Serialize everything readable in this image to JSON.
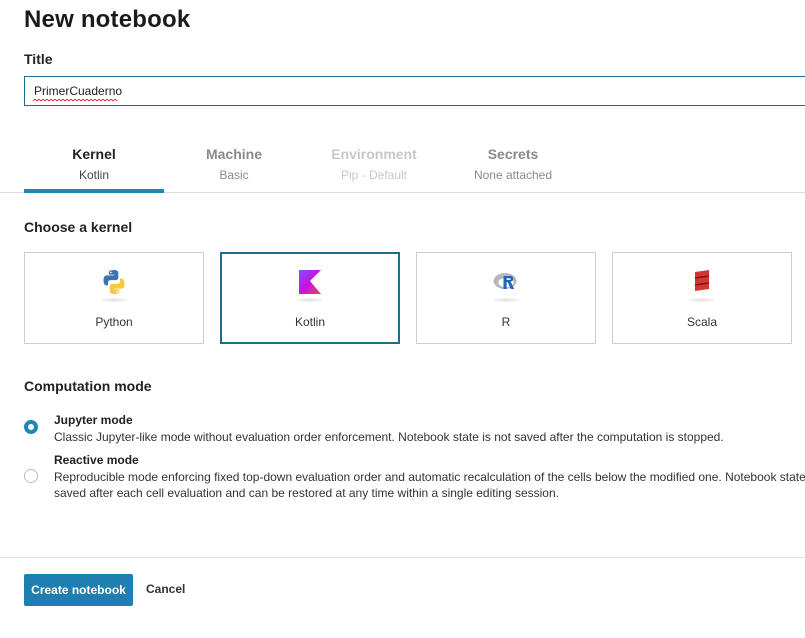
{
  "page": {
    "title": "New notebook"
  },
  "title_field": {
    "label": "Title",
    "value": "PrimerCuaderno"
  },
  "tabs": [
    {
      "label": "Kernel",
      "sub": "Kotlin",
      "state": "active"
    },
    {
      "label": "Machine",
      "sub": "Basic",
      "state": "normal"
    },
    {
      "label": "Environment",
      "sub": "Pip - Default",
      "state": "disabled"
    },
    {
      "label": "Secrets",
      "sub": "None attached",
      "state": "normal"
    }
  ],
  "kernel_section": {
    "heading": "Choose a kernel",
    "cards": [
      {
        "label": "Python",
        "icon": "python-icon",
        "selected": false
      },
      {
        "label": "Kotlin",
        "icon": "kotlin-icon",
        "selected": true
      },
      {
        "label": "R",
        "icon": "r-icon",
        "selected": false
      },
      {
        "label": "Scala",
        "icon": "scala-icon",
        "selected": false
      }
    ]
  },
  "computation": {
    "heading": "Computation mode",
    "modes": [
      {
        "title": "Jupyter mode",
        "description": "Classic Jupyter-like mode without evaluation order enforcement. Notebook state is not saved after the computation is stopped.",
        "checked": true
      },
      {
        "title": "Reactive mode",
        "description": "Reproducible mode enforcing fixed top-down evaluation order and automatic recalculation of the cells below the modified one. Notebook state is saved after each cell evaluation and can be restored at any time within a single editing session.",
        "checked": false
      }
    ]
  },
  "footer": {
    "create_label": "Create notebook",
    "cancel_label": "Cancel"
  },
  "colors": {
    "accent": "#1e88b4",
    "primary_button": "#1e7fb0",
    "selected_border": "#1e6d8c"
  }
}
